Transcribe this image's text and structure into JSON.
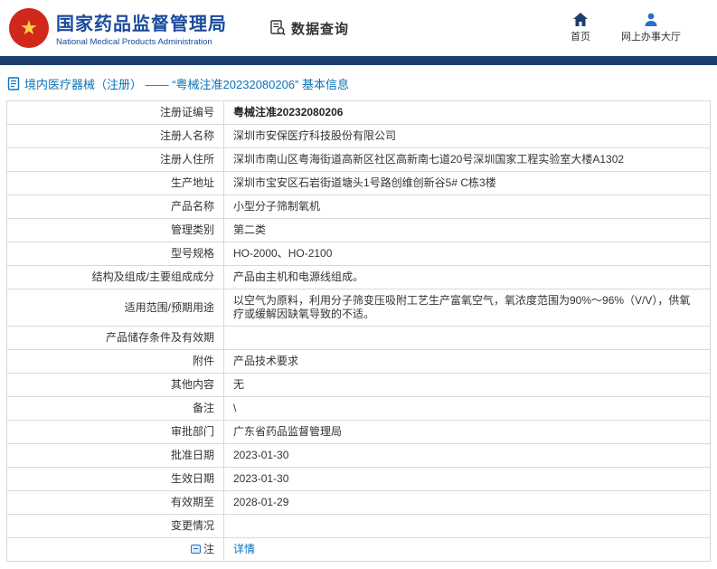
{
  "colors": {
    "accent_blue": "#1a4a9c",
    "navy_bar": "#1c3f6e",
    "link_blue": "#0b72b9",
    "emblem_red": "#d0291c",
    "emblem_gold": "#ffd24a"
  },
  "header": {
    "agency_cn": "国家药品监督管理局",
    "agency_en": "National Medical Products Administration",
    "section_label": "数据查询",
    "nav": [
      {
        "label": "首页",
        "icon": "home-icon"
      },
      {
        "label": "网上办事大厅",
        "icon": "user-icon"
      }
    ]
  },
  "breadcrumb": {
    "text": "境内医疗器械（注册） ——  “粤械注准20232080206”  基本信息"
  },
  "table": {
    "rows": [
      {
        "label": "注册证编号",
        "value": "粤械注准20232080206",
        "bold": true
      },
      {
        "label": "注册人名称",
        "value": "深圳市安保医疗科技股份有限公司"
      },
      {
        "label": "注册人住所",
        "value": "深圳市南山区粤海街道高新区社区高新南七道20号深圳国家工程实验室大楼A1302"
      },
      {
        "label": "生产地址",
        "value": "深圳市宝安区石岩街道塘头1号路创维创新谷5# C栋3楼"
      },
      {
        "label": "产品名称",
        "value": "小型分子筛制氧机"
      },
      {
        "label": "管理类别",
        "value": "第二类"
      },
      {
        "label": "型号规格",
        "value": "HO-2000、HO-2100"
      },
      {
        "label": "结构及组成/主要组成成分",
        "value": "产品由主机和电源线组成。"
      },
      {
        "label": "适用范围/预期用途",
        "value": "以空气为原料，利用分子筛变压吸附工艺生产富氧空气，氧浓度范围为90%～96%（V/V），供氧疗或缓解因缺氧导致的不适。"
      },
      {
        "label": "产品储存条件及有效期",
        "value": ""
      },
      {
        "label": "附件",
        "value": "产品技术要求"
      },
      {
        "label": "其他内容",
        "value": "无"
      },
      {
        "label": "备注",
        "value": "\\"
      },
      {
        "label": "审批部门",
        "value": "广东省药品监督管理局"
      },
      {
        "label": "批准日期",
        "value": "2023-01-30"
      },
      {
        "label": "生效日期",
        "value": "2023-01-30"
      },
      {
        "label": "有效期至",
        "value": "2028-01-29"
      },
      {
        "label": "变更情况",
        "value": ""
      },
      {
        "label": "注",
        "label_icon": "note-icon",
        "value": "详情",
        "link": true
      }
    ]
  }
}
